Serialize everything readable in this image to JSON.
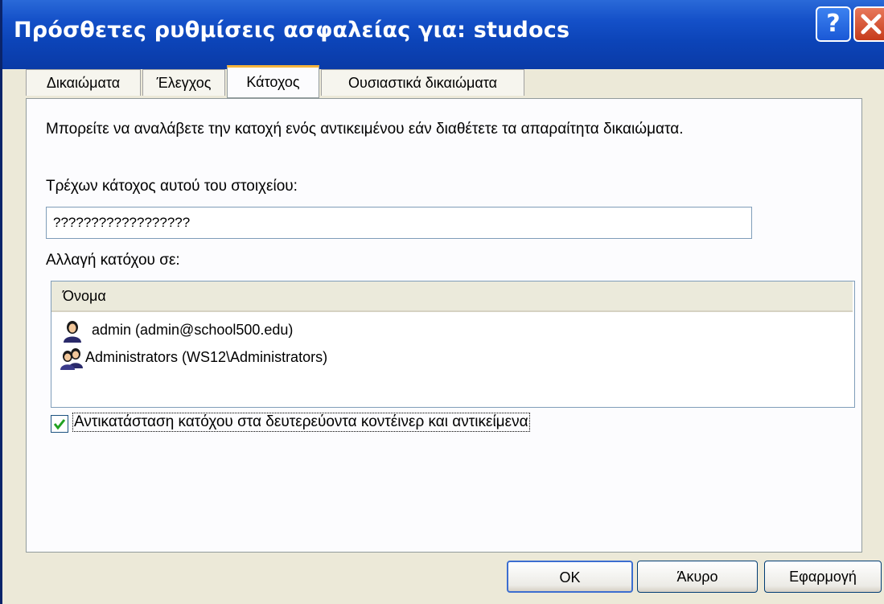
{
  "window": {
    "title": "Πρόσθετες ρυθμίσεις ασφαλείας για: studocs",
    "help_label": "?"
  },
  "tabs": [
    {
      "label": "Δικαιώματα",
      "active": false
    },
    {
      "label": "Έλεγχος",
      "active": false
    },
    {
      "label": "Κάτοχος",
      "active": true
    },
    {
      "label": "Ουσιαστικά δικαιώματα",
      "active": false
    }
  ],
  "owner_tab": {
    "info_text": "Μπορείτε να αναλάβετε την κατοχή ενός αντικειμένου εάν διαθέτετε τα απαραίτητα δικαιώματα.",
    "current_owner_label": "Τρέχων κάτοχος αυτού του στοιχείου:",
    "current_owner_value": "??????????????????",
    "change_owner_label": "Αλλαγή κατόχου σε:",
    "list_header": "Όνομα",
    "list_items": [
      {
        "name": "admin (admin@school500.edu)",
        "icon": "user-icon"
      },
      {
        "name": "Administrators (WS12\\Administrators)",
        "icon": "group-icon"
      }
    ],
    "replace_owner_checkbox": {
      "label": "Αντικατάσταση κατόχου στα δευτερεύοντα κοντέινερ και αντικείμενα",
      "checked": true
    }
  },
  "buttons": {
    "ok": "OK",
    "cancel": "Άκυρο",
    "apply": "Εφαρμογή"
  },
  "colors": {
    "titlebar": "#0a3aa6",
    "active_tab_accent": "#f5b43c",
    "checkmark": "#21a121"
  }
}
